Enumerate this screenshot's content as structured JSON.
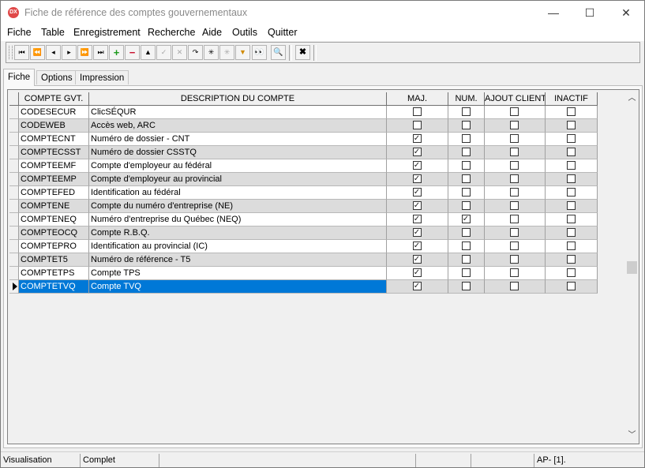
{
  "window": {
    "app_icon_text": "DX",
    "title": "Fiche de référence des comptes gouvernementaux",
    "minimize_glyph": "—",
    "maximize_glyph": "☐",
    "close_glyph": "✕"
  },
  "menu": [
    "Fiche",
    "Table",
    "Enregistrement",
    "Recherche",
    "Aide",
    "Outils",
    "Quitter"
  ],
  "toolbar": {
    "buttons": [
      {
        "name": "first-record-icon",
        "glyph": "⏮"
      },
      {
        "name": "previous-page-icon",
        "glyph": "⏪"
      },
      {
        "name": "previous-record-icon",
        "glyph": "◂"
      },
      {
        "name": "next-record-icon",
        "glyph": "▸"
      },
      {
        "name": "next-page-icon",
        "glyph": "⏩"
      },
      {
        "name": "last-record-icon",
        "glyph": "⏭"
      },
      {
        "name": "add-record-icon",
        "glyph": "+"
      },
      {
        "name": "delete-record-icon",
        "glyph": "−"
      },
      {
        "name": "edit-record-icon",
        "glyph": "▲"
      },
      {
        "name": "confirm-icon",
        "glyph": "✓"
      },
      {
        "name": "cancel-icon",
        "glyph": "✕"
      },
      {
        "name": "refresh-icon",
        "glyph": "↷"
      },
      {
        "name": "filter-all-icon",
        "glyph": "✳"
      },
      {
        "name": "filter-clear-icon",
        "glyph": "✳"
      },
      {
        "name": "filter-icon",
        "glyph": "▼"
      },
      {
        "name": "binoculars-icon",
        "glyph": "👀"
      },
      {
        "name": "search-icon",
        "glyph": "🔍"
      },
      {
        "name": "close-form-icon",
        "glyph": "✖"
      }
    ]
  },
  "tabs": [
    {
      "label": "Fiche",
      "active": true
    },
    {
      "label": "Options",
      "active": false
    },
    {
      "label": "Impression",
      "active": false
    }
  ],
  "grid": {
    "columns": [
      "COMPTE GVT.",
      "DESCRIPTION DU COMPTE",
      "MAJ.",
      "NUM.",
      "AJOUT CLIENT",
      "INACTIF"
    ],
    "rows": [
      {
        "code": "CODESECUR",
        "description": "ClicSÉQUR",
        "maj": false,
        "num": false,
        "ajout": false,
        "inactif": false
      },
      {
        "code": "CODEWEB",
        "description": "Accès web, ARC",
        "maj": false,
        "num": false,
        "ajout": false,
        "inactif": false
      },
      {
        "code": "COMPTECNT",
        "description": "Numéro de dossier - CNT",
        "maj": true,
        "num": false,
        "ajout": false,
        "inactif": false
      },
      {
        "code": "COMPTECSST",
        "description": "Numéro de dossier CSSTQ",
        "maj": true,
        "num": false,
        "ajout": false,
        "inactif": false
      },
      {
        "code": "COMPTEEMF",
        "description": "Compte d'employeur au fédéral",
        "maj": true,
        "num": false,
        "ajout": false,
        "inactif": false
      },
      {
        "code": "COMPTEEMP",
        "description": "Compte d'employeur au provincial",
        "maj": true,
        "num": false,
        "ajout": false,
        "inactif": false
      },
      {
        "code": "COMPTEFED",
        "description": "Identification au fédéral",
        "maj": true,
        "num": false,
        "ajout": false,
        "inactif": false
      },
      {
        "code": "COMPTENE",
        "description": "Compte du numéro d'entreprise (NE)",
        "maj": true,
        "num": false,
        "ajout": false,
        "inactif": false
      },
      {
        "code": "COMPTENEQ",
        "description": "Numéro d'entreprise du Québec (NEQ)",
        "maj": true,
        "num": true,
        "ajout": false,
        "inactif": false
      },
      {
        "code": "COMPTEOCQ",
        "description": "Compte R.B.Q.",
        "maj": true,
        "num": false,
        "ajout": false,
        "inactif": false
      },
      {
        "code": "COMPTEPRO",
        "description": "Identification au provincial (IC)",
        "maj": true,
        "num": false,
        "ajout": false,
        "inactif": false
      },
      {
        "code": "COMPTET5",
        "description": "Numéro de référence - T5",
        "maj": true,
        "num": false,
        "ajout": false,
        "inactif": false
      },
      {
        "code": "COMPTETPS",
        "description": "Compte TPS",
        "maj": true,
        "num": false,
        "ajout": false,
        "inactif": false
      },
      {
        "code": "COMPTETVQ",
        "description": "Compte TVQ",
        "maj": true,
        "num": false,
        "ajout": false,
        "inactif": false,
        "selected": true
      }
    ]
  },
  "scroll": {
    "up_glyph": "︿",
    "down_glyph": "﹀"
  },
  "status": {
    "mode": "Visualisation",
    "state": "Complet",
    "position": "AP- [1]."
  },
  "colors": {
    "selection": "#0078d7",
    "alt_row": "#dcdcdc",
    "normal_row": "#ffffff"
  }
}
